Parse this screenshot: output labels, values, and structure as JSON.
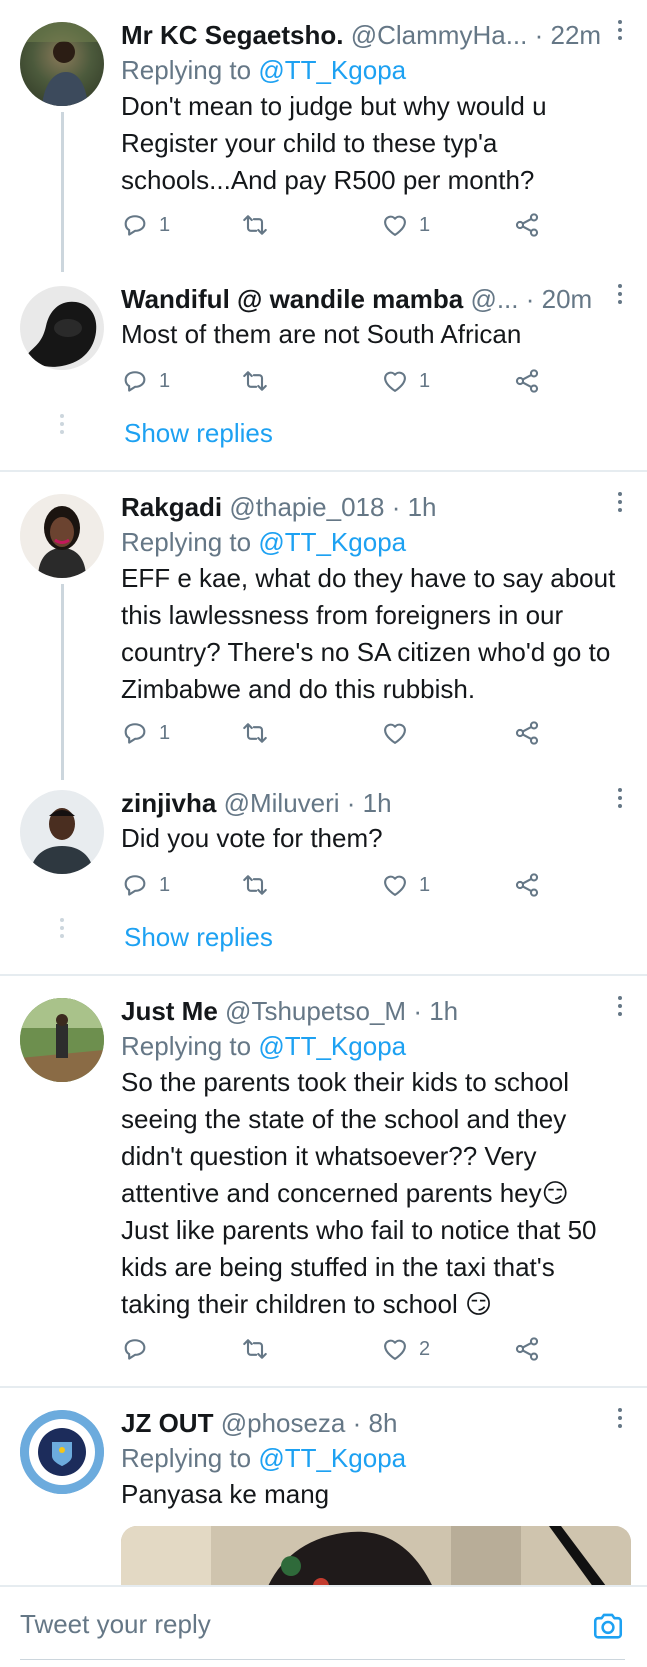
{
  "tweets": [
    {
      "name": "Mr KC Segaetsho.",
      "handle": "@ClammyHa...",
      "time": "· 22m",
      "replying_label": "Replying to",
      "replying_to": "@TT_Kgopa",
      "lines": [
        "Don't mean to judge but why would u",
        "Register your child to these typ'a",
        "schools...And pay R500 per month?"
      ],
      "reply_count": "1",
      "retweet_count": "",
      "like_count": "1"
    },
    {
      "name": "Wandiful @ wandile mamba",
      "handle": "@...",
      "time": "· 20m",
      "lines": [
        "Most of them are not South African"
      ],
      "reply_count": "1",
      "retweet_count": "",
      "like_count": "1"
    },
    {
      "name": "Rakgadi",
      "handle": "@thapie_018",
      "time": "· 1h",
      "replying_label": "Replying to",
      "replying_to": "@TT_Kgopa",
      "lines": [
        "EFF e kae, what do they have to say about",
        "this lawlessness from foreigners in our",
        "country? There's no SA citizen who'd go to",
        "Zimbabwe and do this rubbish."
      ],
      "reply_count": "1",
      "retweet_count": "",
      "like_count": ""
    },
    {
      "name": "zinjivha",
      "handle": "@Miluveri",
      "time": "· 1h",
      "lines": [
        "Did you vote for them?"
      ],
      "reply_count": "1",
      "retweet_count": "",
      "like_count": "1"
    },
    {
      "name": "Just Me",
      "handle": "@Tshupetso_M",
      "time": "· 1h",
      "replying_label": "Replying to",
      "replying_to": "@TT_Kgopa",
      "lines": [
        "So the parents took their kids to school",
        "seeing the state of the school and they",
        "didn't question it whatsoever?? Very",
        "attentive and concerned parents hey😏",
        "Just like parents who fail to notice that 50",
        "kids are being stuffed in the taxi that's",
        "taking their children to school 😏"
      ],
      "reply_count": "",
      "retweet_count": "",
      "like_count": "2"
    },
    {
      "name": "JZ OUT",
      "handle": "@phoseza",
      "time": "· 8h",
      "replying_label": "Replying to",
      "replying_to": "@TT_Kgopa",
      "lines": [
        "Panyasa ke mang"
      ]
    }
  ],
  "show_replies_label": "Show replies",
  "reply_bar": {
    "placeholder": "Tweet your reply"
  },
  "colors": {
    "accent": "#1da1f2",
    "muted": "#657786",
    "text": "#14171a",
    "divider": "#e6ecf0"
  },
  "icons": [
    "reply-icon",
    "retweet-icon",
    "like-icon",
    "share-icon",
    "more-menu-icon",
    "camera-icon"
  ]
}
